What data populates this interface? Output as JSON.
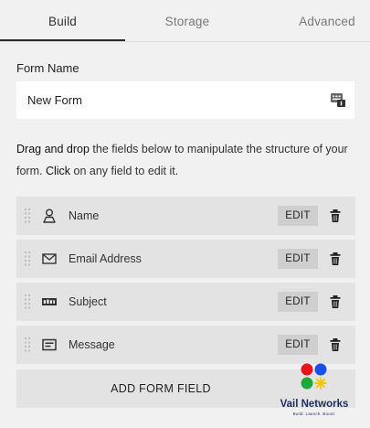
{
  "tabs": [
    {
      "label": "Build",
      "active": true
    },
    {
      "label": "Storage",
      "active": false
    },
    {
      "label": "Advanced",
      "active": false
    }
  ],
  "form_name": {
    "label": "Form Name",
    "value": "New Form",
    "icon": "form-name-icon"
  },
  "instructions": {
    "part1_bold": "Drag and drop",
    "part2": " the fields below to manipulate the structure of your form. ",
    "part3_bold": "Click",
    "part4": " on any field to edit it."
  },
  "fields": [
    {
      "label": "Name",
      "icon": "person-icon",
      "edit_label": "EDIT"
    },
    {
      "label": "Email Address",
      "icon": "envelope-icon",
      "edit_label": "EDIT"
    },
    {
      "label": "Subject",
      "icon": "abc-text-icon",
      "edit_label": "EDIT"
    },
    {
      "label": "Message",
      "icon": "textarea-icon",
      "edit_label": "EDIT"
    }
  ],
  "add_field_label": "ADD FORM FIELD",
  "watermark": {
    "title": "Vail Networks",
    "subtitle": "Build. Launch. Boost."
  },
  "colors": {
    "panel_bg": "#f1f1f1",
    "row_bg": "#e3e3e3",
    "edit_bg": "#cfcfcf",
    "watermark_text": "#1c2f5e"
  }
}
